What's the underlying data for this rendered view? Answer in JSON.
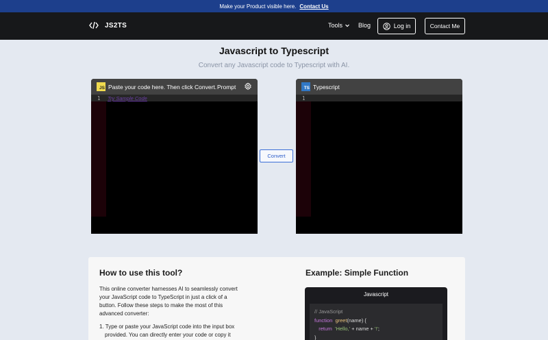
{
  "announcement": {
    "text": "Make your Product visible here.",
    "link": "Contact Us"
  },
  "nav": {
    "brand": "JS2TS",
    "tools": "Tools",
    "blog": "Blog",
    "login": "Log in",
    "contact": "Contact Me"
  },
  "page": {
    "title": "Javascript to Typescript",
    "subtitle": "Convert any Javascript code to Typescript with AI."
  },
  "editor_left": {
    "badge": "JS",
    "header": "Paste your code here. Then click Convert.",
    "prompt": "Prompt",
    "line_number": "1",
    "sample_link": "Try Sample Code"
  },
  "editor_right": {
    "badge": "TS",
    "header": "Typescript",
    "line_number": "1"
  },
  "convert_button": "Convert",
  "howto": {
    "title": "How to use this tool?",
    "intro": "This online converter harnesses AI to seamlessly convert your JavaScript code to TypeScript in just a click of a button. Follow these steps to make the most of this advanced converter:",
    "steps": [
      "1. Type or paste your JavaScript code into the input box provided. You can directly enter your code or copy it"
    ]
  },
  "example": {
    "title": "Example: Simple Function",
    "tab": "Javascript",
    "comment": "// JavaScript",
    "kw_function": "function",
    "fn_name": "greet",
    "params": "(name)  {",
    "kw_return": "return",
    "str_hello": "'Hello,'",
    "concat": "  +  name  +  ",
    "str_bang": "'!'",
    "end": ";",
    "close": "}"
  },
  "colors": {
    "announcement_bg": "#1d3f8c",
    "nav_bg": "#17181a",
    "page_bg": "#e4e9f1",
    "js_badge": "#f0db4f",
    "ts_badge": "#3178c6",
    "convert_accent": "#3b6fd8"
  },
  "icons": [
    "code-icon",
    "chevron-down-icon",
    "user-circle-icon",
    "gear-icon"
  ]
}
